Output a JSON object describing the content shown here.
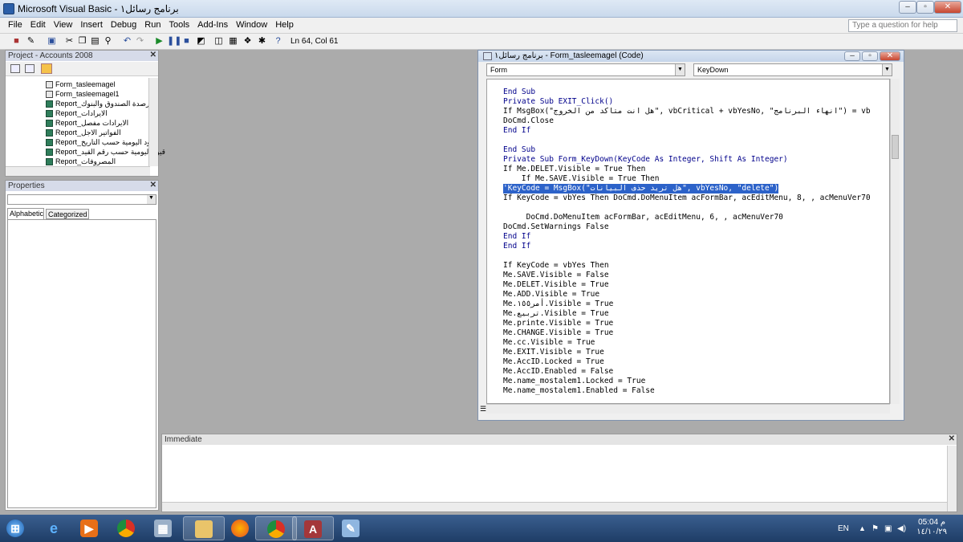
{
  "window": {
    "title": "Microsoft Visual Basic - برنامج رسائل١"
  },
  "menu": [
    "File",
    "Edit",
    "View",
    "Insert",
    "Debug",
    "Run",
    "Tools",
    "Add-Ins",
    "Window",
    "Help"
  ],
  "ask_placeholder": "Type a question for help",
  "toolbar": {
    "position": "Ln 64, Col 61"
  },
  "project": {
    "title": "Project - Accounts 2008",
    "items": [
      {
        "label": "Form_tasleemagel",
        "kind": "form"
      },
      {
        "label": "Form_tasleemagel1",
        "kind": "form"
      },
      {
        "label": "Report_ارصدة الصندوق والبنوك",
        "kind": "report"
      },
      {
        "label": "Report_الايرادات",
        "kind": "report"
      },
      {
        "label": "Report_الايرادات مفصل",
        "kind": "report"
      },
      {
        "label": "Report_الفواتير الاجل",
        "kind": "report"
      },
      {
        "label": "Report_قيود اليومية حسب التاريخ",
        "kind": "report"
      },
      {
        "label": "Report_قيود اليومية حسب رقم القيد",
        "kind": "report"
      },
      {
        "label": "Report_المصروفات",
        "kind": "report"
      }
    ]
  },
  "properties": {
    "title": "Properties",
    "tabs": [
      "Alphabetic",
      "Categorized"
    ]
  },
  "code": {
    "title": "برنامج رسائل١ - Form_tasleemagel (Code)",
    "object_combo": "Form",
    "proc_combo": "KeyDown",
    "lines": [
      {
        "t": "End Sub",
        "k": true
      },
      {
        "t": "Private Sub EXIT_Click()",
        "k": true
      },
      {
        "t": "If MsgBox(\"هل انت متاكد من الخروج\", vbCritical + vbYesNo, \"انهاء البرنامج\") = vb",
        "k": false
      },
      {
        "t": "DoCmd.Close",
        "k": false
      },
      {
        "t": "End If",
        "k": true
      },
      {
        "t": "",
        "k": false
      },
      {
        "t": "End Sub",
        "k": true
      },
      {
        "t": "Private Sub Form_KeyDown(KeyCode As Integer, Shift As Integer)",
        "k": true
      },
      {
        "t": "If Me.DELET.Visible = True Then",
        "k": false
      },
      {
        "t": "    If Me.SAVE.Visible = True Then",
        "k": false
      },
      {
        "t": "'KeyCode = MsgBox(\"هل تريد حذف البيانات\", vbYesNo, \"delete\")",
        "k": false,
        "sel": true
      },
      {
        "t": "If KeyCode = vbYes Then DoCmd.DoMenuItem acFormBar, acEditMenu, 8, , acMenuVer70",
        "k": false
      },
      {
        "t": "",
        "k": false
      },
      {
        "t": "     DoCmd.DoMenuItem acFormBar, acEditMenu, 6, , acMenuVer70",
        "k": false
      },
      {
        "t": "DoCmd.SetWarnings False",
        "k": false
      },
      {
        "t": "End If",
        "k": true
      },
      {
        "t": "End If",
        "k": true
      },
      {
        "t": "",
        "k": false
      },
      {
        "t": "If KeyCode = vbYes Then",
        "k": false
      },
      {
        "t": "Me.SAVE.Visible = False",
        "k": false
      },
      {
        "t": "Me.DELET.Visible = True",
        "k": false
      },
      {
        "t": "Me.ADD.Visible = True",
        "k": false
      },
      {
        "t": "Me.أمر١٥٥.Visible = True",
        "k": false
      },
      {
        "t": "Me.تربيع.Visible = True",
        "k": false
      },
      {
        "t": "Me.printe.Visible = True",
        "k": false
      },
      {
        "t": "Me.CHANGE.Visible = True",
        "k": false
      },
      {
        "t": "Me.cc.Visible = True",
        "k": false
      },
      {
        "t": "Me.EXIT.Visible = True",
        "k": false
      },
      {
        "t": "Me.AccID.Locked = True",
        "k": false
      },
      {
        "t": "Me.AccID.Enabled = False",
        "k": false
      },
      {
        "t": "Me.name_mostalem1.Locked = True",
        "k": false
      },
      {
        "t": "Me.name_mostalem1.Enabled = False",
        "k": false
      }
    ]
  },
  "immediate": {
    "title": "Immediate"
  },
  "taskbar": {
    "lang": "EN",
    "time": "05:04 م",
    "date": "١٤/١٠/٢٩"
  }
}
